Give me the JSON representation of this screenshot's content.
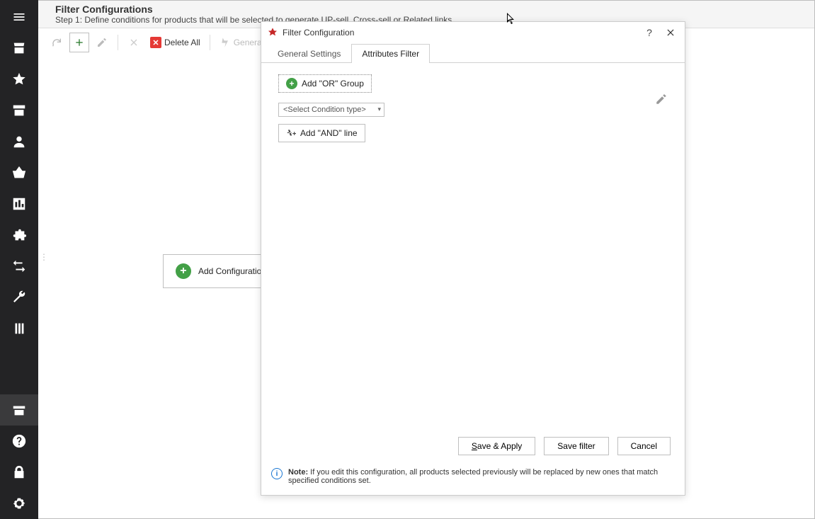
{
  "header": {
    "title": "Filter Configurations",
    "subtitle": "Step 1: Define conditions for products that will be selected to generate UP-sell, Cross-sell or Related links"
  },
  "toolbar": {
    "delete_all_label": "Delete All",
    "generate_auto_label": "Generate Automatically"
  },
  "main": {
    "add_configuration_label": "Add Configuration"
  },
  "modal": {
    "title": "Filter Configuration",
    "help_symbol": "?",
    "tabs": {
      "general": "General Settings",
      "attributes": "Attributes Filter"
    },
    "or_group_label": "Add \"OR\" Group",
    "condition_placeholder": "<Select Condition type>",
    "and_line_label": "Add \"AND\" line",
    "buttons": {
      "save_apply": "Save & Apply",
      "save_filter": "Save filter",
      "cancel": "Cancel"
    },
    "note_label": "Note:",
    "note_text": "If you edit this configuration, all products selected previously will be replaced by new ones that match specified conditions set."
  },
  "sidebar": {
    "items": [
      {
        "name": "menu-icon"
      },
      {
        "name": "store-icon"
      },
      {
        "name": "star-icon"
      },
      {
        "name": "archive-icon"
      },
      {
        "name": "person-icon"
      },
      {
        "name": "basket-icon"
      },
      {
        "name": "chart-icon"
      },
      {
        "name": "puzzle-icon"
      },
      {
        "name": "transfer-icon"
      },
      {
        "name": "wrench-icon"
      },
      {
        "name": "layers-icon"
      }
    ],
    "bottom": [
      {
        "name": "box-icon",
        "active": true
      },
      {
        "name": "help-icon"
      },
      {
        "name": "lock-icon"
      },
      {
        "name": "gear-icon"
      }
    ]
  }
}
